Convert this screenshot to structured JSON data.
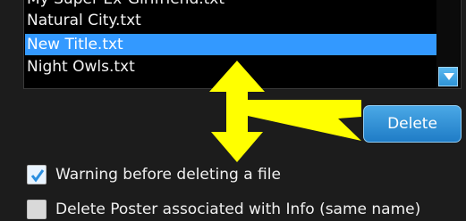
{
  "files": {
    "items": [
      {
        "label": "My Super Ex-Girlfriend.txt"
      },
      {
        "label": "Natural City.txt"
      },
      {
        "label": "New Title.txt"
      },
      {
        "label": "Night Owls.txt"
      }
    ],
    "selected_label": "New Title.txt"
  },
  "actions": {
    "delete_label": "Delete"
  },
  "options": {
    "warning": {
      "label": "Warning before deleting a file",
      "checked": true
    },
    "delete_poster": {
      "label": "Delete Poster associated with Info (same name)",
      "checked": false
    }
  },
  "colors": {
    "selection": "#3399ff",
    "accent": "#2e93d6",
    "annotation_arrow": "#ffff00"
  },
  "icons": {
    "scroll": "chevron-down-icon",
    "check": "checkmark-icon",
    "annotation": "yellow-arrow-icon"
  }
}
